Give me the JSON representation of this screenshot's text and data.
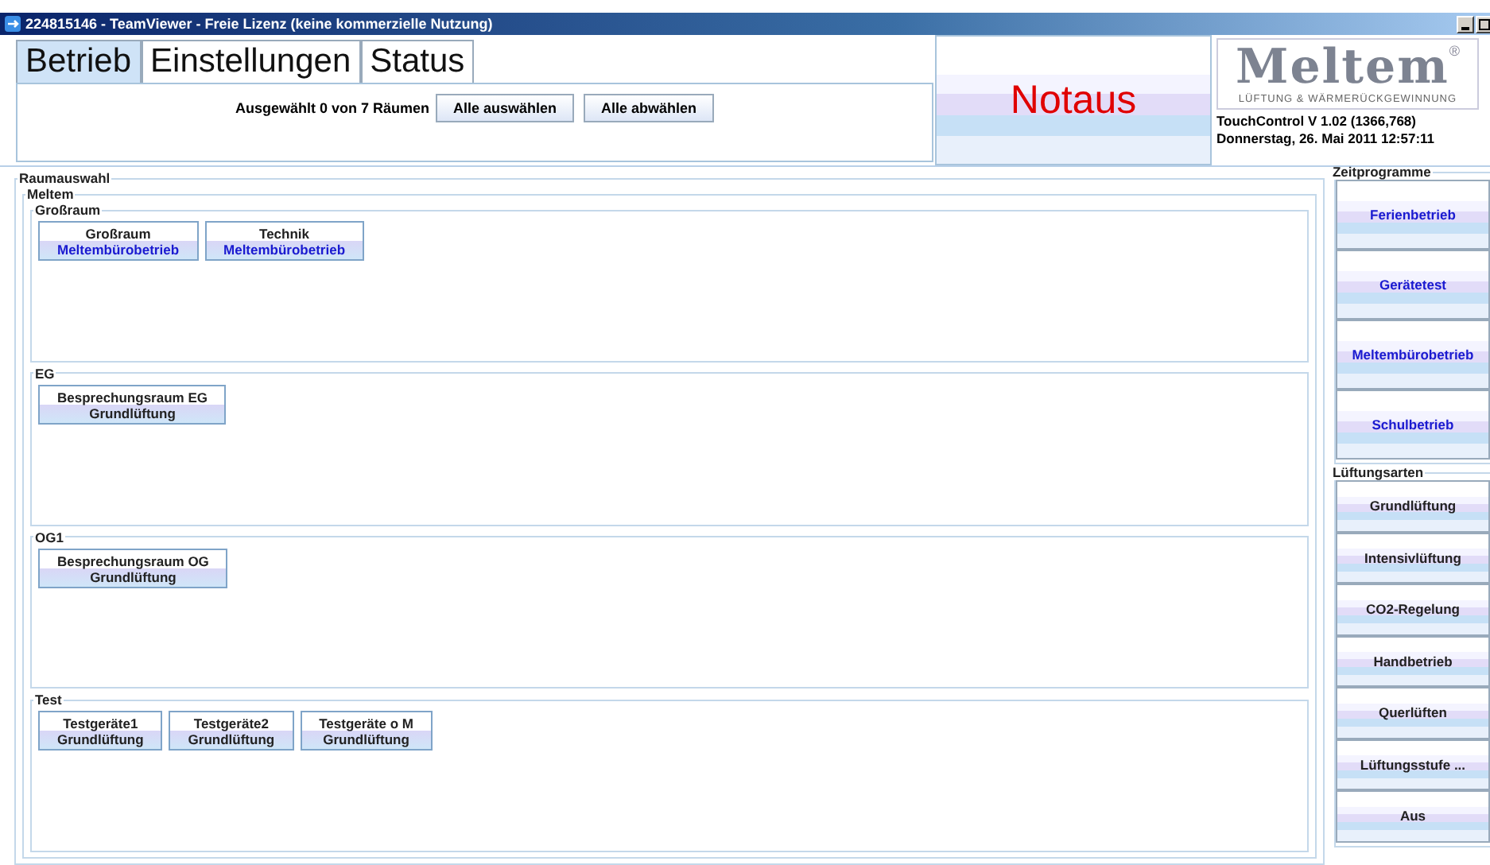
{
  "window": {
    "title": "224815146 - TeamViewer - Freie Lizenz (keine kommerzielle Nutzung)"
  },
  "tabs": [
    {
      "label": "Betrieb",
      "selected": true
    },
    {
      "label": "Einstellungen",
      "selected": false
    },
    {
      "label": "Status",
      "selected": false
    }
  ],
  "selection": {
    "summary": "Ausgewählt 0 von 7 Räumen",
    "buttons": [
      "Alle auswählen",
      "Alle abwählen"
    ]
  },
  "emergency_button": "Notaus",
  "logo": {
    "wordmark": "Meltem",
    "registered": "®",
    "tagline": "LÜFTUNG & WÄRMERÜCKGEWINNUNG"
  },
  "info": [
    "TouchControl V 1.02 (1366,768)",
    "Donnerstag, 26. Mai 2011 12:57:11"
  ],
  "room_selection": {
    "title": "Raumauswahl",
    "site": "Meltem",
    "groups": [
      {
        "title": "Großraum",
        "rooms": [
          {
            "name": "Großraum",
            "mode": "Meltembürobetrieb",
            "color": "#1a1ad0"
          },
          {
            "name": "Technik",
            "mode": "Meltembürobetrieb",
            "color": "#1a1ad0"
          }
        ]
      },
      {
        "title": "EG",
        "rooms": [
          {
            "name": "Besprechungsraum EG",
            "mode": "Grundlüftung",
            "color": "#222222"
          }
        ]
      },
      {
        "title": "OG1",
        "rooms": [
          {
            "name": "Besprechungsraum OG",
            "mode": "Grundlüftung",
            "color": "#222222"
          }
        ]
      },
      {
        "title": "Test",
        "rooms": [
          {
            "name": "Testgeräte1",
            "mode": "Grundlüftung",
            "color": "#222222"
          },
          {
            "name": "Testgeräte2",
            "mode": "Grundlüftung",
            "color": "#222222"
          },
          {
            "name": "Testgeräte o M",
            "mode": "Grundlüftung",
            "color": "#222222"
          }
        ]
      }
    ]
  },
  "sidebar": [
    {
      "title": "Zeitprogramme",
      "kind": "program",
      "buttons": [
        "Ferienbetrieb",
        "Gerätetest",
        "Meltembürobetrieb",
        "Schulbetrieb"
      ]
    },
    {
      "title": "Lüftungsarten",
      "kind": "mode",
      "buttons": [
        "Grundlüftung",
        "Intensivlüftung",
        "CO2-Regelung",
        "Handbetrieb",
        "Querlüften",
        "Lüftungsstufe ...",
        "Aus"
      ]
    }
  ]
}
